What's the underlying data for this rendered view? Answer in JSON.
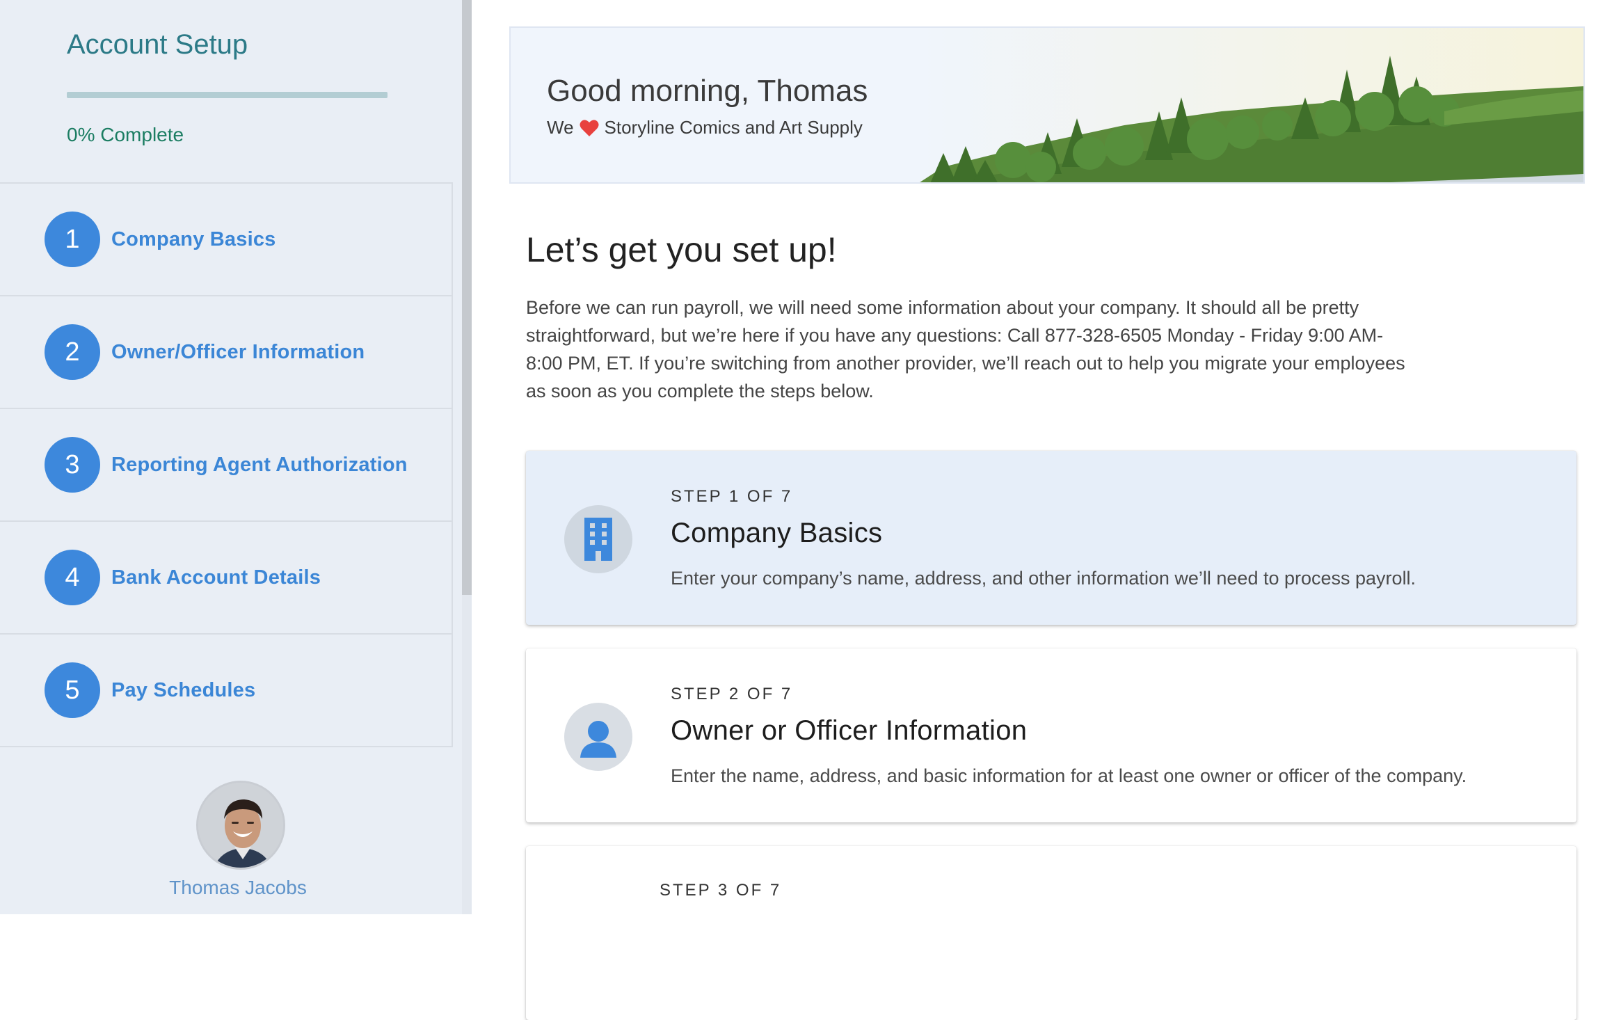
{
  "sidebar": {
    "title": "Account Setup",
    "progress_percent": 0,
    "progress_text": "0% Complete",
    "steps": [
      {
        "number": "1",
        "label": "Company Basics"
      },
      {
        "number": "2",
        "label": "Owner/Officer Information"
      },
      {
        "number": "3",
        "label": "Reporting Agent Authorization"
      },
      {
        "number": "4",
        "label": "Bank Account Details"
      },
      {
        "number": "5",
        "label": "Pay Schedules"
      }
    ],
    "user_name": "Thomas Jacobs"
  },
  "banner": {
    "greeting": "Good morning, Thomas",
    "love_prefix": "We",
    "love_icon": "heart-icon",
    "company": "Storyline Comics and Art Supply"
  },
  "main": {
    "heading": "Let’s get you set up!",
    "intro": "Before we can run payroll, we will need some information about your company. It should all be pretty straightforward, but we’re here if you have any questions: Call 877-328-6505 Monday - Friday 9:00 AM-8:00 PM, ET. If you’re switching from another provider, we’ll reach out to help you migrate your employees as soon as you complete the steps below.",
    "cards": [
      {
        "kicker": "STEP 1 OF 7",
        "title": "Company Basics",
        "description": "Enter your company’s name, address, and other information we’ll need to process payroll.",
        "icon": "building-icon"
      },
      {
        "kicker": "STEP 2 OF 7",
        "title": "Owner or Officer Information",
        "description": "Enter the name, address, and basic information for at least one owner or officer of the company.",
        "icon": "person-icon"
      },
      {
        "kicker": "STEP 3 OF 7"
      }
    ]
  },
  "colors": {
    "accent": "#3d88dc",
    "title_teal": "#2c7a87",
    "progress_green": "#1b7d62",
    "heart": "#e8413e"
  }
}
